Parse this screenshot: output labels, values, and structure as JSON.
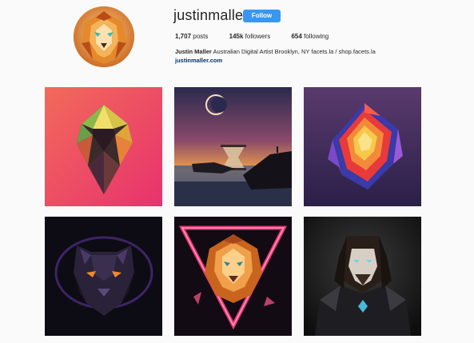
{
  "profile": {
    "username": "justinmaller",
    "follow_label": "Follow",
    "posts_count": "1,707",
    "posts_label": "posts",
    "followers_count": "145k",
    "followers_label": "followers",
    "following_count": "654",
    "following_label": "following",
    "full_name": "Justin Maller",
    "bio": "Australian Digital Artist Brooklyn, NY facets.la / shop.facets.la",
    "website": "justinmaller.com",
    "avatar_icon": "lion-avatar"
  },
  "colors": {
    "follow_button": "#3897f0",
    "link": "#003569",
    "background": "#fafafa"
  },
  "posts": [
    {
      "subject": "geometric-crystal-art",
      "bg": "#f0506a"
    },
    {
      "subject": "hourglass-landscape-art",
      "bg": "#5a3a5e"
    },
    {
      "subject": "geometric-flame-art",
      "bg": "#3d2a5e"
    },
    {
      "subject": "panther-art",
      "bg": "#0d0c14"
    },
    {
      "subject": "lion-triangle-art",
      "bg": "#120b14"
    },
    {
      "subject": "warrior-portrait-art",
      "bg": "#141414"
    }
  ]
}
